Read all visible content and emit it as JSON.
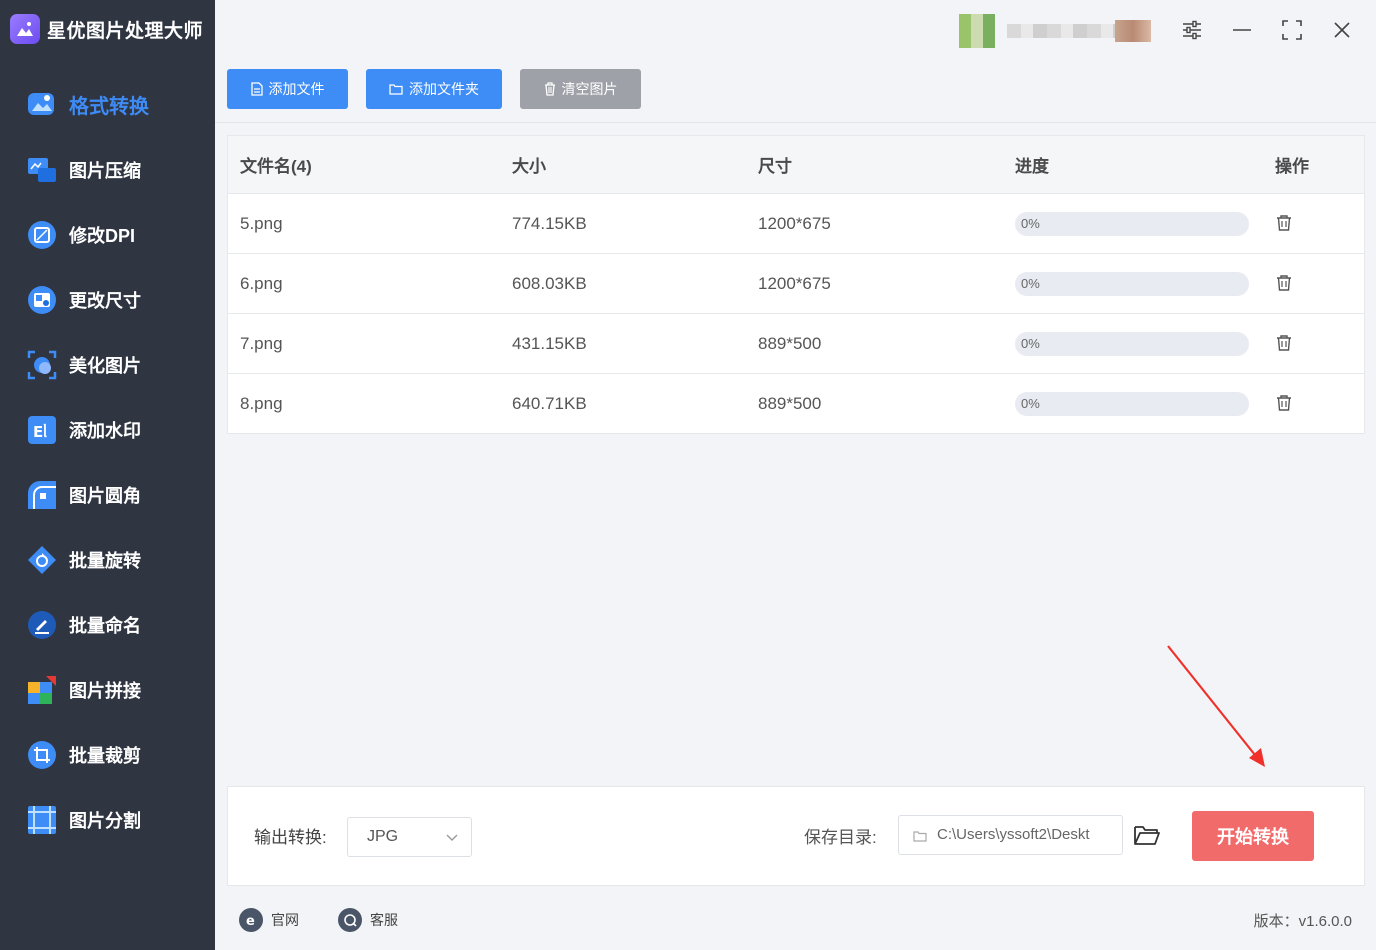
{
  "app": {
    "title": "星优图片处理大师"
  },
  "sidebar": {
    "items": [
      {
        "label": "格式转换",
        "icon": "image-convert-icon",
        "active": true
      },
      {
        "label": "图片压缩",
        "icon": "compress-icon"
      },
      {
        "label": "修改DPI",
        "icon": "dpi-icon"
      },
      {
        "label": "更改尺寸",
        "icon": "resize-icon"
      },
      {
        "label": "美化图片",
        "icon": "beautify-icon"
      },
      {
        "label": "添加水印",
        "icon": "watermark-icon"
      },
      {
        "label": "图片圆角",
        "icon": "rounded-corner-icon"
      },
      {
        "label": "批量旋转",
        "icon": "rotate-icon"
      },
      {
        "label": "批量命名",
        "icon": "rename-icon"
      },
      {
        "label": "图片拼接",
        "icon": "puzzle-icon"
      },
      {
        "label": "批量裁剪",
        "icon": "crop-icon"
      },
      {
        "label": "图片分割",
        "icon": "split-icon"
      }
    ]
  },
  "toolbar": {
    "add_file": "添加文件",
    "add_folder": "添加文件夹",
    "clear": "清空图片"
  },
  "table": {
    "headers": {
      "name": "文件名(4)",
      "size": "大小",
      "dimensions": "尺寸",
      "progress": "进度",
      "action": "操作"
    },
    "rows": [
      {
        "name": "5.png",
        "size": "774.15KB",
        "dimensions": "1200*675",
        "progress": 0,
        "progress_text": "0%"
      },
      {
        "name": "6.png",
        "size": "608.03KB",
        "dimensions": "1200*675",
        "progress": 0,
        "progress_text": "0%"
      },
      {
        "name": "7.png",
        "size": "431.15KB",
        "dimensions": "889*500",
        "progress": 0,
        "progress_text": "0%"
      },
      {
        "name": "8.png",
        "size": "640.71KB",
        "dimensions": "889*500",
        "progress": 0,
        "progress_text": "0%"
      }
    ]
  },
  "output": {
    "format_label": "输出转换:",
    "format_value": "JPG",
    "save_label": "保存目录:",
    "save_path": "C:\\Users\\yssoft2\\Deskt",
    "start_label": "开始转换"
  },
  "footer": {
    "website": "官网",
    "support": "客服",
    "version": "版本：v1.6.0.0"
  },
  "colors": {
    "sidebar_bg": "#2f3541",
    "accent": "#3e8cf6",
    "start_button": "#f26b6b",
    "clear_button": "#9ea1a8"
  }
}
